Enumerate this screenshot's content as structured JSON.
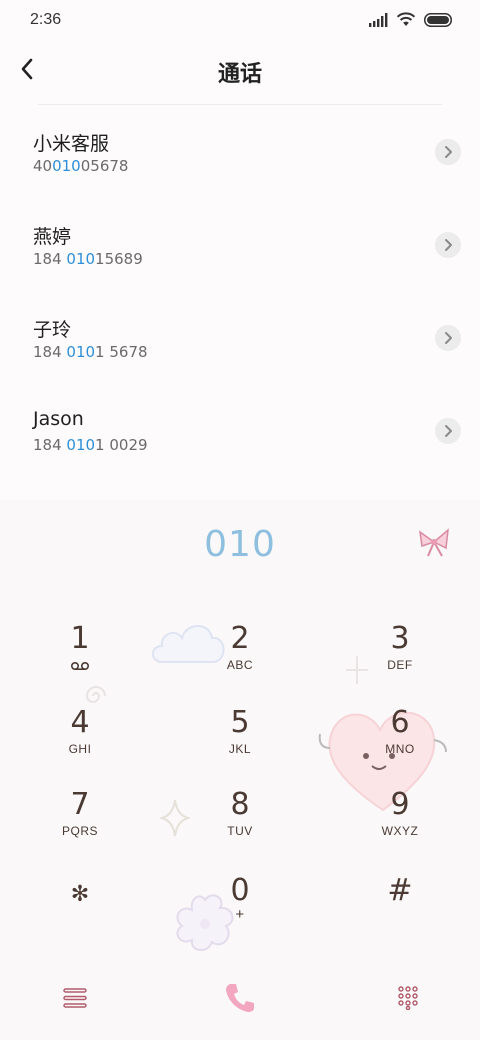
{
  "status_bar": {
    "time": "2:36",
    "icons": [
      "signal-icon",
      "wifi-icon",
      "battery-icon"
    ]
  },
  "header": {
    "title": "通话",
    "back_icon": "back-arrow-icon"
  },
  "contacts": [
    {
      "name": "小米客服",
      "number_pre": "40",
      "number_hl": "010",
      "number_post": "05678"
    },
    {
      "name": "燕婷",
      "number_pre": "184 ",
      "number_hl": "010",
      "number_post": "15689"
    },
    {
      "name": "子玲",
      "number_pre": "184 ",
      "number_hl": "010",
      "number_post": "1 5678"
    },
    {
      "name": "Jason",
      "number_pre": "184 ",
      "number_hl": "010",
      "number_post": "1 0029"
    }
  ],
  "dialer": {
    "number": "010",
    "keys": [
      {
        "digit": "1",
        "letters": ""
      },
      {
        "digit": "2",
        "letters": "ABC"
      },
      {
        "digit": "3",
        "letters": "DEF"
      },
      {
        "digit": "4",
        "letters": "GHI"
      },
      {
        "digit": "5",
        "letters": "JKL"
      },
      {
        "digit": "6",
        "letters": "MNO"
      },
      {
        "digit": "7",
        "letters": "PQRS"
      },
      {
        "digit": "8",
        "letters": "TUV"
      },
      {
        "digit": "9",
        "letters": "WXYZ"
      },
      {
        "digit": "✻",
        "letters": ""
      },
      {
        "digit": "0",
        "letters": "+"
      },
      {
        "digit": "#",
        "letters": ""
      }
    ]
  },
  "colors": {
    "highlight": "#2d8fd8",
    "dial_number": "#8fbfdf",
    "call_button": "#f2a6bf",
    "key_text": "#4a3a33"
  }
}
